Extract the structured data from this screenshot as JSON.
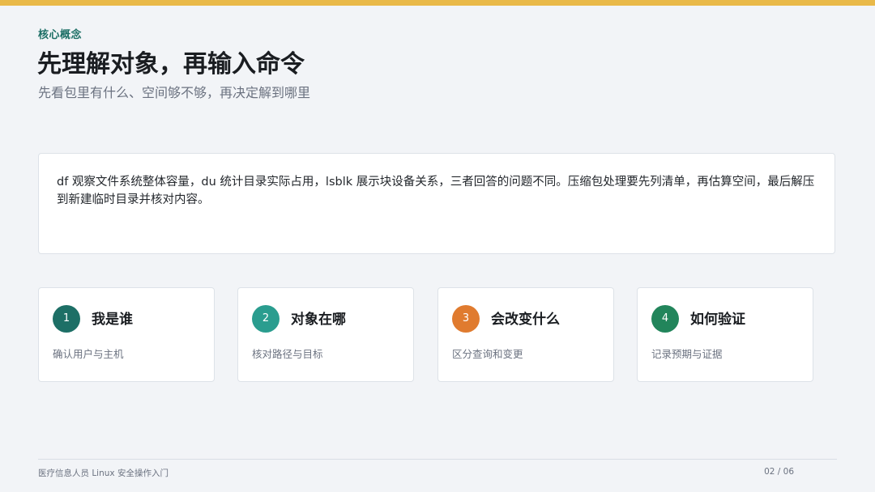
{
  "header": {
    "eyebrow": "核心概念",
    "title": "先理解对象，再输入命令",
    "subtitle": "先看包里有什么、空间够不够，再决定解到哪里",
    "accent_color": "#e9b949"
  },
  "summary": {
    "text": "df 观察文件系统整体容量，du 统计目录实际占用，lsblk 展示块设备关系，三者回答的问题不同。压缩包处理要先列清单，再估算空间，最后解压到新建临时目录并核对内容。"
  },
  "cards": [
    {
      "number": "1",
      "title": "我是谁",
      "desc": "确认用户与主机",
      "color": "#1d6f66"
    },
    {
      "number": "2",
      "title": "对象在哪",
      "desc": "核对路径与目标",
      "color": "#2a9d8f"
    },
    {
      "number": "3",
      "title": "会改变什么",
      "desc": "区分查询和变更",
      "color": "#e07b2f"
    },
    {
      "number": "4",
      "title": "如何验证",
      "desc": "记录预期与证据",
      "color": "#22855b"
    }
  ],
  "footer": {
    "course": "医疗信息人员 Linux 安全操作入门",
    "page": "02 / 06"
  }
}
